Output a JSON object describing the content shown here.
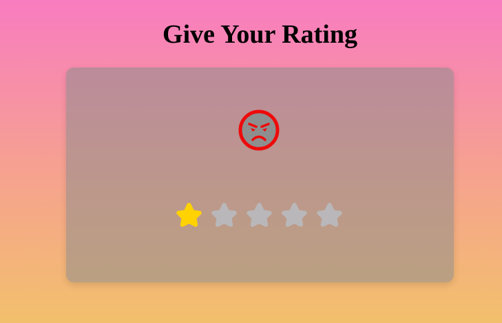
{
  "page": {
    "title": "Give Your Rating"
  },
  "rating": {
    "value": 1,
    "max": 5,
    "mood_icon": "angry-face-icon",
    "filled_color": "#ffd200",
    "empty_color": "#b9b7b9",
    "mood_color": "#ee0a0a",
    "mood_fill": "#8e8e8e"
  }
}
